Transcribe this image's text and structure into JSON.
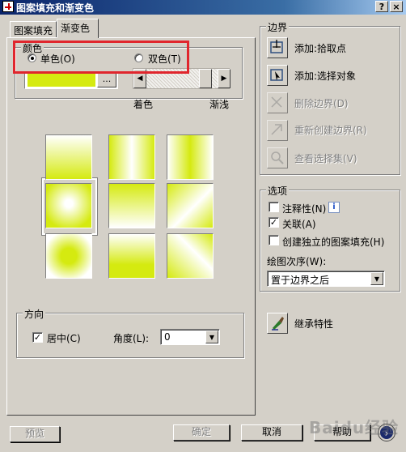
{
  "window": {
    "title": "图案填充和渐变色",
    "help_button": "?",
    "close_button": "×"
  },
  "tabs": [
    {
      "label": "图案填充",
      "active": false
    },
    {
      "label": "渐变色",
      "active": true
    }
  ],
  "color_group": {
    "label": "颜色",
    "one_color": {
      "label": "单色(O)",
      "selected": true
    },
    "two_color": {
      "label": "双色(T)",
      "selected": false
    },
    "swatch_color": "#d5ea10",
    "browse_label": "...",
    "slider_left_arrow": "◀",
    "slider_right_arrow": "▶",
    "shade_label": "着色",
    "tint_label": "渐浅",
    "slider_value": 0.9
  },
  "gradient_patterns": {
    "base_color": "#d5ea10",
    "selected_index": 3,
    "items": [
      "linear-top",
      "cylinder-horizontal",
      "inverted-cylinder-horizontal",
      "spherical",
      "hemispherical",
      "curved",
      "inverted-spherical",
      "inverted-hemispherical",
      "inverted-curved"
    ]
  },
  "orientation_group": {
    "label": "方向",
    "centered": {
      "label": "居中(C)",
      "checked": true
    },
    "angle_label": "角度(L):",
    "angle_value": "0"
  },
  "boundaries_group": {
    "label": "边界",
    "buttons": [
      {
        "label": "添加:拾取点",
        "enabled": true,
        "icon": "pick-points-icon"
      },
      {
        "label": "添加:选择对象",
        "enabled": true,
        "icon": "select-objects-icon"
      },
      {
        "label": "删除边界(D)",
        "enabled": false,
        "icon": "remove-boundaries-icon"
      },
      {
        "label": "重新创建边界(R)",
        "enabled": false,
        "icon": "recreate-boundary-icon"
      },
      {
        "label": "查看选择集(V)",
        "enabled": false,
        "icon": "magnifier-icon"
      }
    ]
  },
  "options_group": {
    "label": "选项",
    "annotative": {
      "label": "注释性(N)",
      "checked": false,
      "info": "i"
    },
    "associative": {
      "label": "关联(A)",
      "checked": true
    },
    "separate_hatches": {
      "label": "创建独立的图案填充(H)",
      "checked": false
    },
    "draw_order_label": "绘图次序(W):",
    "draw_order_value": "置于边界之后"
  },
  "inherit_properties": {
    "label": "继承特性",
    "icon": "brush-icon"
  },
  "footer": {
    "preview": "预览",
    "ok": "确定",
    "cancel": "取消",
    "help": "帮助",
    "more": "›"
  },
  "watermark": "Baidu经验"
}
